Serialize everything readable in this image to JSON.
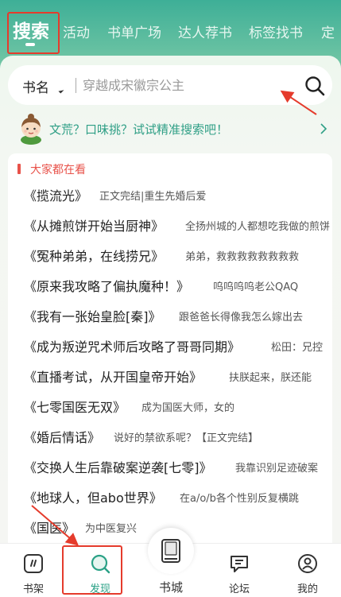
{
  "top_tabs": {
    "items": [
      {
        "label": "搜索",
        "active": true
      },
      {
        "label": "活动"
      },
      {
        "label": "书单广场"
      },
      {
        "label": "达人荐书"
      },
      {
        "label": "标签找书"
      },
      {
        "label": "定"
      }
    ]
  },
  "search": {
    "scope_label": "书名",
    "placeholder": "穿越成宋徽宗公主"
  },
  "tip": {
    "text": "文荒？口味挑？试试精准搜索吧！"
  },
  "hot": {
    "section_title": "大家都在看",
    "books": [
      {
        "title": "《揽流光》",
        "desc": "正文完结|重生先婚后爱"
      },
      {
        "title": "《从摊煎饼开始当厨神》",
        "desc": "全扬州城的人都想吃我做的煎饼"
      },
      {
        "title": "《冤种弟弟，在线捞兄》",
        "desc": "弟弟，救救救救救救救救"
      },
      {
        "title": "《原来我攻略了偏执魔种！》",
        "desc": "呜呜呜呜老公QAQ"
      },
      {
        "title": "《我有一张始皇脸[秦]》",
        "desc": "跟爸爸长得像我怎么嫁出去"
      },
      {
        "title": "《成为叛逆咒术师后攻略了哥哥同期》",
        "desc": "松田：兄控"
      },
      {
        "title": "《直播考试，从开国皇帝开始》",
        "desc": "扶朕起来，朕还能"
      },
      {
        "title": "《七零国医无双》",
        "desc": "成为国医大师，女的"
      },
      {
        "title": "《婚后情话》",
        "desc": "说好的禁欲系呢？【正文完结】"
      },
      {
        "title": "《交换人生后靠破案逆袭[七零]》",
        "desc": "我靠识别足迹破案"
      },
      {
        "title": "《地球人，但abo世界》",
        "desc": "在a/o/b各个性别反复横跳"
      },
      {
        "title": "《国医》",
        "desc": "为中医复兴"
      }
    ]
  },
  "bottom_nav": {
    "items": [
      {
        "label": "书架",
        "icon": "bookshelf-icon"
      },
      {
        "label": "发现",
        "icon": "discover-icon",
        "active": true
      },
      {
        "label": "书城",
        "icon": "book-city-icon"
      },
      {
        "label": "论坛",
        "icon": "forum-icon"
      },
      {
        "label": "我的",
        "icon": "profile-icon"
      }
    ]
  },
  "colors": {
    "header_green": "#3eaf97",
    "accent_green": "#2aa186",
    "hot_red": "#e8524a",
    "annotation_red": "#e53b2c"
  }
}
